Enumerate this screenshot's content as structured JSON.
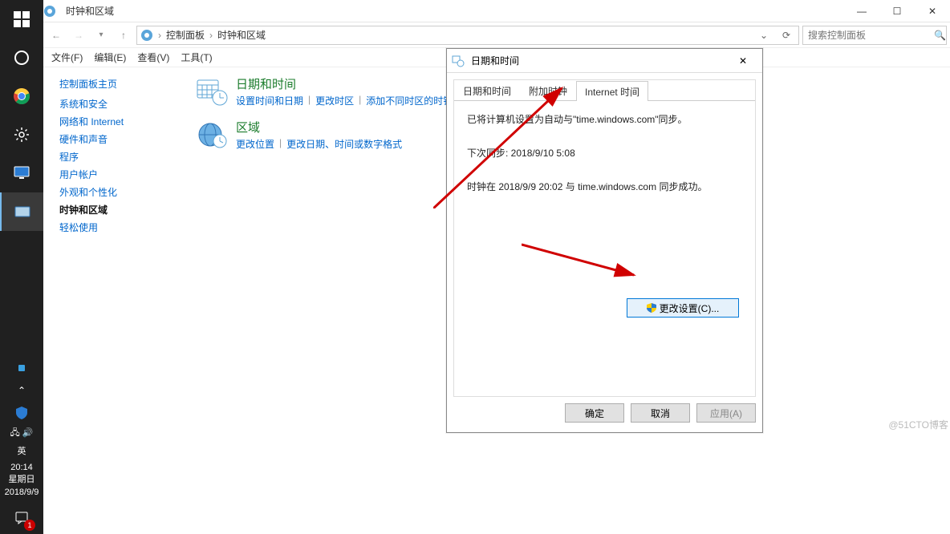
{
  "taskbar": {
    "ime": "英",
    "clock": {
      "time": "20:14",
      "weekday": "星期日",
      "date": "2018/9/9"
    },
    "notif_badge": "1"
  },
  "window": {
    "title": "时钟和区域",
    "winbtn_min": "—",
    "winbtn_max": "☐",
    "winbtn_close": "✕",
    "address": {
      "root": "控制面板",
      "sep": "›",
      "leaf": "时钟和区域"
    },
    "refresh_icon": "⟳",
    "dropdown_icon": "⌄",
    "search_placeholder": "搜索控制面板",
    "menus": [
      "文件(F)",
      "编辑(E)",
      "查看(V)",
      "工具(T)"
    ]
  },
  "sidebar": {
    "title": "控制面板主页",
    "items": [
      "系统和安全",
      "网络和 Internet",
      "硬件和声音",
      "程序",
      "用户帐户",
      "外观和个性化",
      "时钟和区域",
      "轻松使用"
    ],
    "active_index": 6
  },
  "main": {
    "cat1": {
      "title": "日期和时间",
      "links": [
        "设置时间和日期",
        "更改时区",
        "添加不同时区的时钟"
      ]
    },
    "cat2": {
      "title": "区域",
      "links": [
        "更改位置",
        "更改日期、时间或数字格式"
      ]
    }
  },
  "dialog": {
    "title": "日期和时间",
    "close": "✕",
    "tabs": [
      "日期和时间",
      "附加时钟",
      "Internet 时间"
    ],
    "active_tab": 2,
    "line1": "已将计算机设置为自动与\"time.windows.com\"同步。",
    "line2": "下次同步: 2018/9/10 5:08",
    "line3": "时钟在 2018/9/9 20:02 与 time.windows.com 同步成功。",
    "change_button": "更改设置(C)...",
    "ok": "确定",
    "cancel": "取消",
    "apply": "应用(A)"
  },
  "watermark": "@51CTO博客"
}
